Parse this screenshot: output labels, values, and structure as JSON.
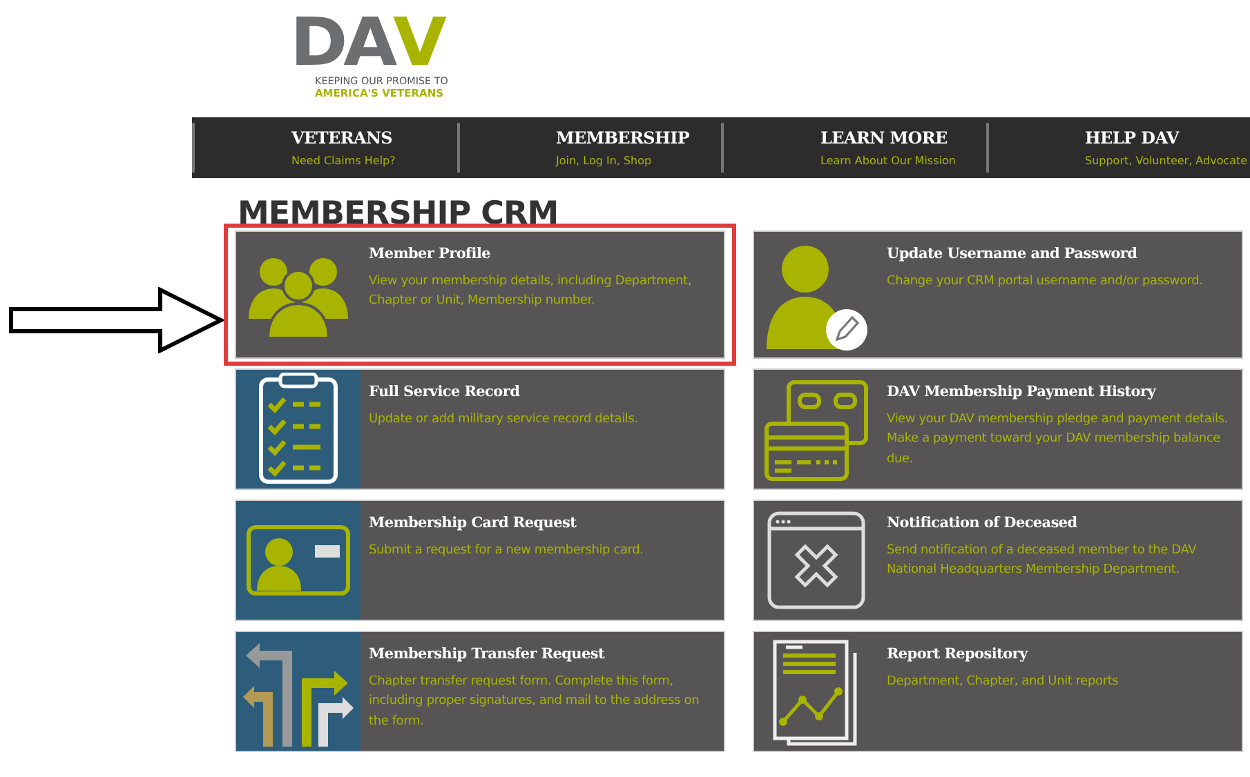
{
  "logo": {
    "wordmark": [
      {
        "text": "DA",
        "color": "#6d6e70"
      },
      {
        "text": "V",
        "color": "#a8b400"
      }
    ],
    "tagline_1": "KEEPING OUR PROMISE TO",
    "tagline_2": "AMERICA'S VETERANS"
  },
  "nav": [
    {
      "title": "VETERANS",
      "subtitle": "Need Claims Help?"
    },
    {
      "title": "MEMBERSHIP",
      "subtitle": "Join, Log In, Shop"
    },
    {
      "title": "LEARN MORE",
      "subtitle": "Learn About Our Mission"
    },
    {
      "title": "HELP DAV",
      "subtitle": "Support, Volunteer, Advocate"
    }
  ],
  "heading": "MEMBERSHIP CRM",
  "tiles": [
    {
      "kind": "people",
      "title": "Member Profile",
      "description": "View your membership details, including Department, Chapter or Unit, Membership number.",
      "selected": true
    },
    {
      "kind": "user-edit",
      "title": "Update Username and Password",
      "description": "Change your CRM portal username and/or password.",
      "selected": false
    },
    {
      "kind": "checklist",
      "title": "Full Service Record",
      "description": "Update or add military service record details.",
      "selected": false
    },
    {
      "kind": "cards",
      "title": "DAV Membership Payment History",
      "description": "View your DAV membership pledge and payment details. Make a payment toward your DAV membership balance due.",
      "selected": false
    },
    {
      "kind": "id-card",
      "title": "Membership Card Request",
      "description": "Submit a request for a new membership card.",
      "selected": false
    },
    {
      "kind": "window-x",
      "title": "Notification of Deceased",
      "description": "Send notification of a deceased member to the DAV National Headquarters Membership Department.",
      "selected": false
    },
    {
      "kind": "arrows",
      "title": "Membership Transfer Request",
      "description": "Chapter transfer request form. Complete this form, including proper signatures, and mail to the address on the form.",
      "selected": false
    },
    {
      "kind": "report",
      "title": "Report Repository",
      "description": "Department, Chapter, and Unit reports",
      "selected": false
    }
  ]
}
